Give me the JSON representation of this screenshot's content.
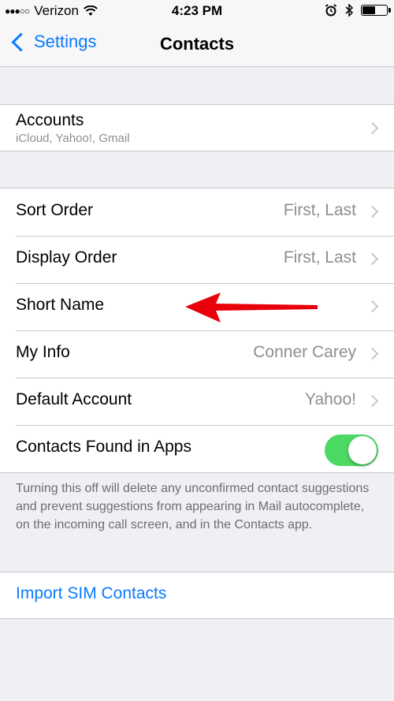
{
  "status_bar": {
    "carrier": "Verizon",
    "time": "4:23 PM",
    "signal_dots": "●●●○○",
    "battery_level": 0.5
  },
  "nav": {
    "back_label": "Settings",
    "title": "Contacts"
  },
  "accounts": {
    "label": "Accounts",
    "subtitle": "iCloud, Yahoo!, Gmail"
  },
  "settings": {
    "sort_order": {
      "label": "Sort Order",
      "value": "First, Last"
    },
    "display_order": {
      "label": "Display Order",
      "value": "First, Last"
    },
    "short_name": {
      "label": "Short Name"
    },
    "my_info": {
      "label": "My Info",
      "value": "Conner Carey"
    },
    "default_account": {
      "label": "Default Account",
      "value": "Yahoo!"
    },
    "contacts_found": {
      "label": "Contacts Found in Apps",
      "enabled": true
    }
  },
  "footer_note": "Turning this off will delete any unconfirmed contact suggestions and prevent suggestions from appearing in Mail autocomplete, on the incoming call screen, and in the Contacts app.",
  "import_sim": "Import SIM Contacts",
  "colors": {
    "accent": "#0a7aff",
    "toggle_on": "#4cd964",
    "arrow": "#e8000b"
  }
}
